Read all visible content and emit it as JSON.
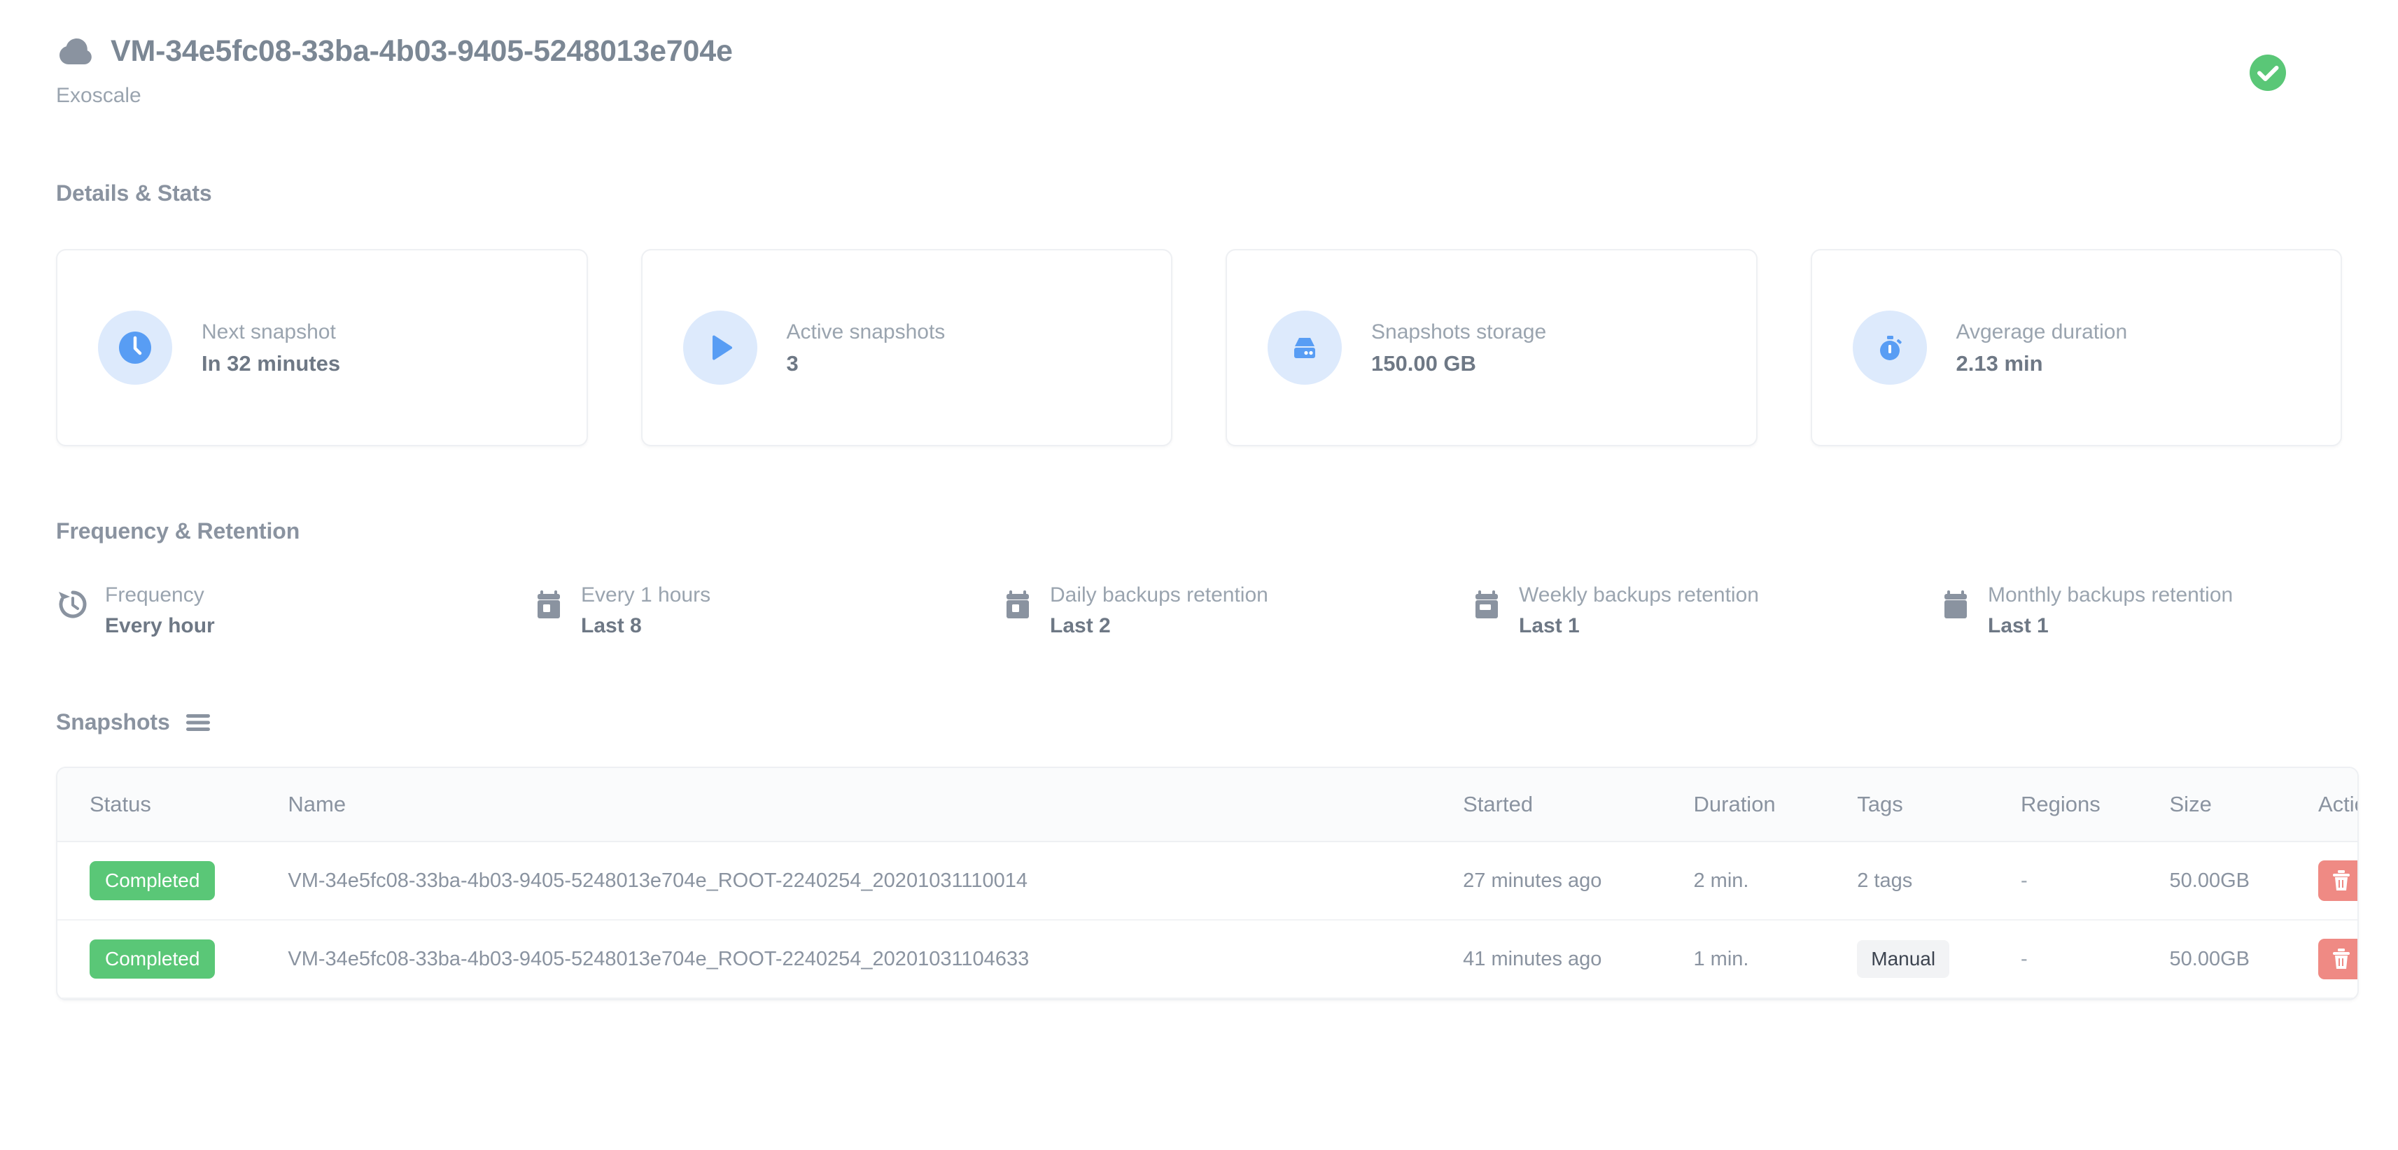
{
  "header": {
    "icon": "cloud-icon",
    "title": "VM-34e5fc08-33ba-4b03-9405-5248013e704e",
    "subtitle": "Exoscale",
    "status_icon": "check-circle-icon",
    "status_color": "#5ac777"
  },
  "details": {
    "section_title": "Details & Stats",
    "cards": [
      {
        "icon": "clock-icon",
        "label": "Next snapshot",
        "value": "In 32 minutes"
      },
      {
        "icon": "play-icon",
        "label": "Active snapshots",
        "value": "3"
      },
      {
        "icon": "hard-drive-icon",
        "label": "Snapshots storage",
        "value": "150.00 GB"
      },
      {
        "icon": "stopwatch-icon",
        "label": "Avgerage duration",
        "value": "2.13 min"
      }
    ],
    "accent_color": "#589df4",
    "icon_bg_color": "#ddeafc"
  },
  "frequency": {
    "section_title": "Frequency & Retention",
    "items": [
      {
        "icon": "history-icon",
        "label": "Frequency",
        "value": "Every hour"
      },
      {
        "icon": "calendar-icon",
        "label": "Every 1 hours",
        "value": "Last 8"
      },
      {
        "icon": "calendar-icon",
        "label": "Daily backups retention",
        "value": "Last 2"
      },
      {
        "icon": "calendar-icon",
        "label": "Weekly backups retention",
        "value": "Last 1"
      },
      {
        "icon": "calendar-icon",
        "label": "Monthly backups retention",
        "value": "Last 1"
      }
    ]
  },
  "snapshots": {
    "section_title": "Snapshots",
    "menu_icon": "hamburger-icon",
    "columns": [
      "Status",
      "Name",
      "Started",
      "Duration",
      "Tags",
      "Regions",
      "Size",
      "Actions"
    ],
    "rows": [
      {
        "status": "Completed",
        "name": "VM-34e5fc08-33ba-4b03-9405-5248013e704e_ROOT-2240254_20201031110014",
        "started": "27 minutes ago",
        "duration": "2 min.",
        "tags": "2 tags",
        "tags_is_chip": false,
        "regions": "-",
        "size": "50.00GB",
        "action_icon": "trash-icon"
      },
      {
        "status": "Completed",
        "name": "VM-34e5fc08-33ba-4b03-9405-5248013e704e_ROOT-2240254_20201031104633",
        "started": "41 minutes ago",
        "duration": "1 min.",
        "tags": "Manual",
        "tags_is_chip": true,
        "regions": "-",
        "size": "50.00GB",
        "action_icon": "trash-icon"
      }
    ],
    "status_color": "#5ac777",
    "delete_color": "#ef8a84"
  }
}
